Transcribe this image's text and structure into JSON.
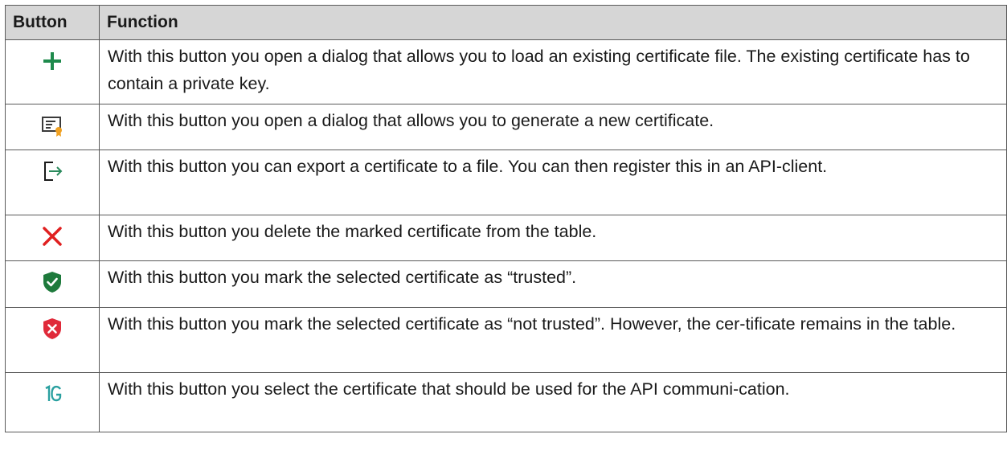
{
  "table": {
    "headers": {
      "button": "Button",
      "function": "Function"
    },
    "rows": [
      {
        "icon": "plus-icon",
        "color": "#1e8a4c",
        "text": "With this button you open a dialog that allows you to load an existing certificate file. The existing certificate has to contain a private key."
      },
      {
        "icon": "certificate-icon",
        "color": "#3a3a3a",
        "text": "With this button you open a dialog that allows you to generate a new certificate."
      },
      {
        "icon": "export-icon",
        "color": "#2a8a5c",
        "text": "With this button you can export a certificate to a file. You can then register this in an API-client."
      },
      {
        "icon": "delete-x-icon",
        "color": "#e02020",
        "text": "With this button you delete the marked certificate from the table."
      },
      {
        "icon": "shield-check-icon",
        "color": "#1e7a3c",
        "text": "With this button you mark the selected certificate as “trusted”."
      },
      {
        "icon": "shield-x-icon",
        "color": "#e02a3a",
        "text": "With this button you mark the selected certificate as “not trusted”. However, the cer-tificate remains in the table."
      },
      {
        "icon": "api-select-icon",
        "color": "#2aa0a0",
        "text": "With this button you select the certificate that should be used for the API communi-cation."
      }
    ]
  }
}
